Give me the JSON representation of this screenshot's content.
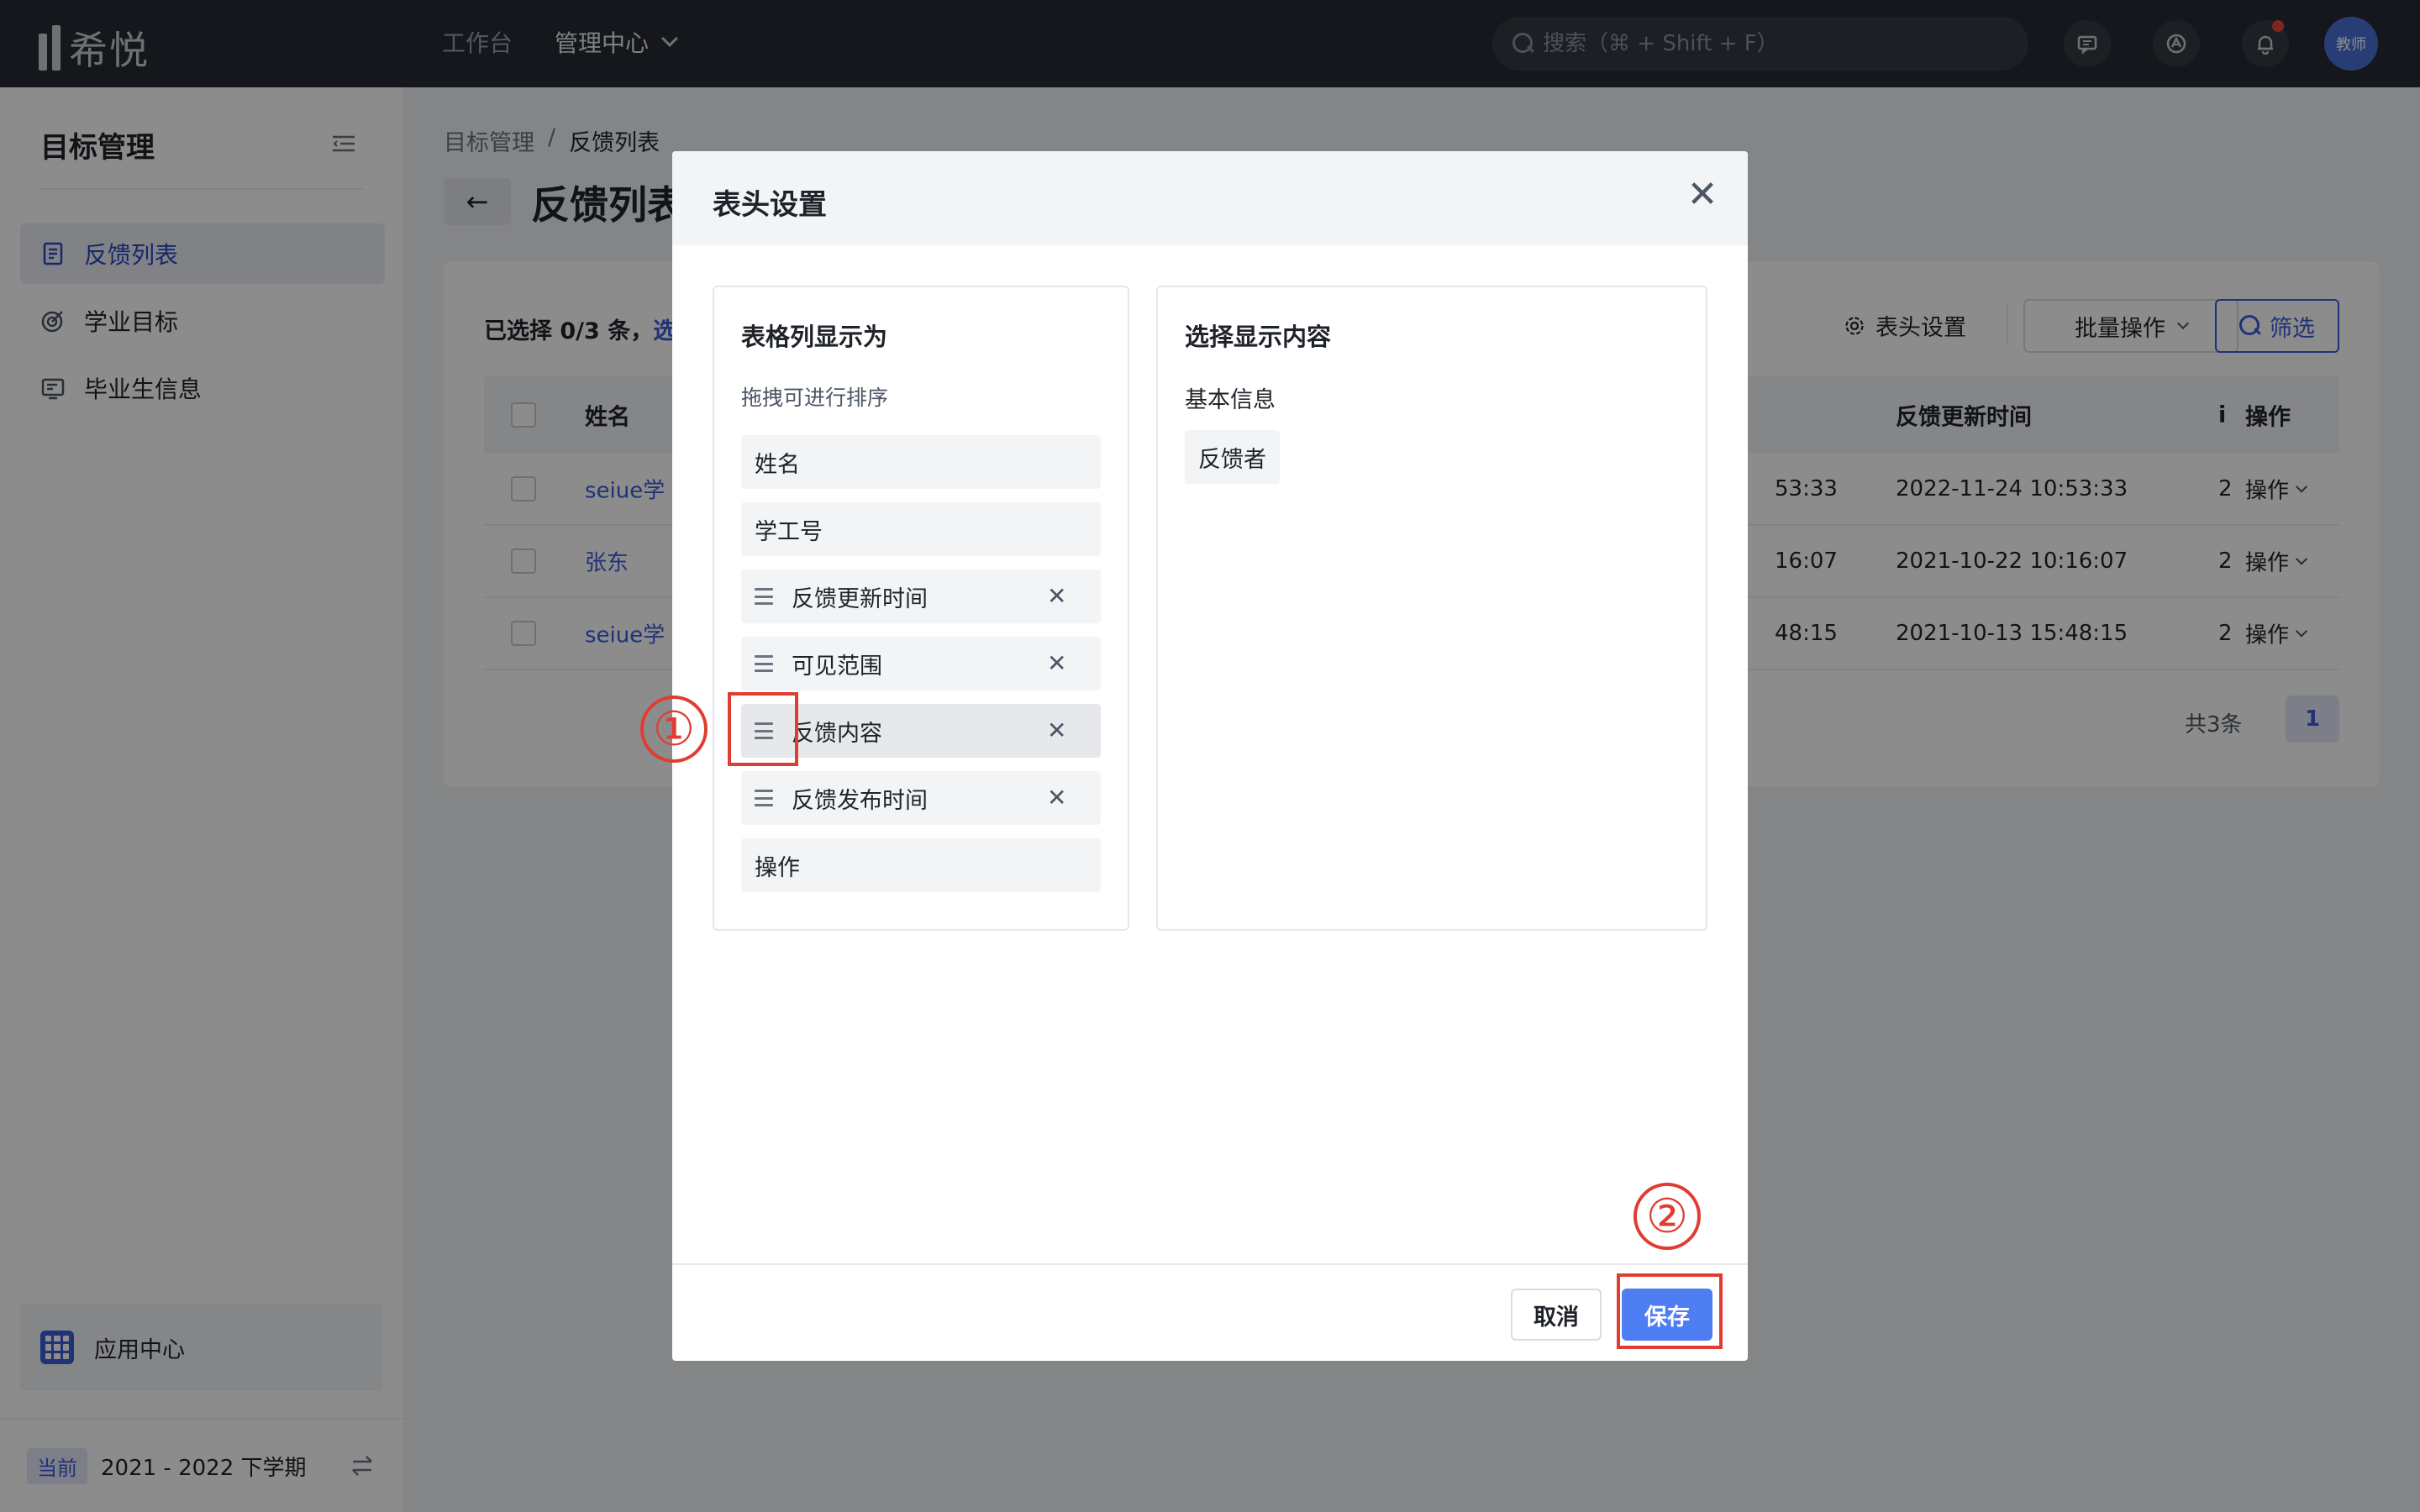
{
  "topbar": {
    "logo_text": "希悦",
    "nav": [
      {
        "label": "工作台",
        "active": false
      },
      {
        "label": "管理中心",
        "active": true
      }
    ],
    "search_placeholder": "搜索（⌘ + Shift + F）",
    "icons": [
      "message-icon",
      "app-icon",
      "bell-icon"
    ],
    "avatar_label": "教师"
  },
  "sidebar": {
    "title": "目标管理",
    "items": [
      {
        "label": "反馈列表",
        "icon": "list-doc-icon",
        "active": true
      },
      {
        "label": "学业目标",
        "icon": "target-icon",
        "active": false
      },
      {
        "label": "毕业生信息",
        "icon": "id-card-icon",
        "active": false
      }
    ],
    "app_center_label": "应用中心",
    "term_badge": "当前",
    "term_label": "2021 - 2022 下学期"
  },
  "main": {
    "breadcrumb": [
      "目标管理",
      "/",
      "反馈列表"
    ],
    "back_label": "←",
    "page_title": "反馈列表",
    "selected_text": "已选择 0/3 条，",
    "selected_link": "选",
    "toolbar": {
      "header_settings": "表头设置",
      "batch_ops": "批量操作",
      "filter": "筛选"
    },
    "table": {
      "headers": {
        "name": "姓名",
        "updated": "反馈更新时间",
        "truncated": "i",
        "ops": "操作"
      },
      "rows": [
        {
          "name": "seiue学",
          "partial_time": "53:33",
          "updated": "2022-11-24 10:53:33",
          "truncated": "2",
          "ops": "操作"
        },
        {
          "name": "张东",
          "partial_time": "16:07",
          "updated": "2021-10-22 10:16:07",
          "truncated": "2",
          "ops": "操作"
        },
        {
          "name": "seiue学",
          "partial_time": "48:15",
          "updated": "2021-10-13 15:48:15",
          "truncated": "2",
          "ops": "操作"
        }
      ]
    },
    "total": "共3条",
    "page": "1"
  },
  "modal": {
    "title": "表头设置",
    "close_label": "✕",
    "left_box": {
      "title": "表格列显示为",
      "hint": "拖拽可进行排序",
      "items": [
        {
          "label": "姓名",
          "draggable": false
        },
        {
          "label": "学工号",
          "draggable": false
        },
        {
          "label": "反馈更新时间",
          "draggable": true
        },
        {
          "label": "可见范围",
          "draggable": true
        },
        {
          "label": "反馈内容",
          "draggable": true
        },
        {
          "label": "反馈发布时间",
          "draggable": true
        },
        {
          "label": "操作",
          "draggable": false
        }
      ],
      "remove_label": "✕"
    },
    "right_box": {
      "title": "选择显示内容",
      "group_label": "基本信息",
      "tags": [
        "反馈者"
      ]
    },
    "footer": {
      "cancel": "取消",
      "save": "保存"
    }
  },
  "annotations": {
    "marker_1": "①",
    "marker_2": "②",
    "color": "#e03c31"
  },
  "colors": {
    "topbar_bg": "#272b34",
    "accent": "#3b5bdb",
    "save_button": "#4f7df2"
  }
}
